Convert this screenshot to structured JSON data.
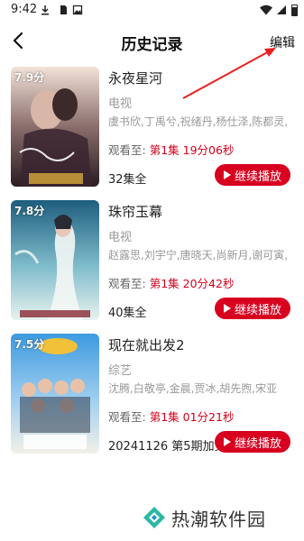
{
  "status_bar": {
    "time": "9:42",
    "icons": [
      "download-icon",
      "sim-card-icon",
      "image-icon",
      "wifi-icon",
      "signal-icon",
      "battery-icon"
    ]
  },
  "nav": {
    "title": "历史记录",
    "edit_label": "编辑",
    "back_icon": "chevron-left-icon"
  },
  "labels": {
    "watched_prefix": "观看至:",
    "continue_label": "继续播放"
  },
  "history": [
    {
      "rating": "7.9分",
      "title": "永夜星河",
      "category": "电视",
      "cast": "虞书欣,丁禹兮,祝绪丹,杨仕泽,陈都灵,",
      "watched_episode": "第1集 19分06秒",
      "episodes": "32集全",
      "poster_text": "11月1日起",
      "colors": [
        "#3b2a2a",
        "#c9a7a0",
        "#f2d6c8"
      ]
    },
    {
      "rating": "7.8分",
      "title": "珠帘玉幕",
      "category": "电视",
      "cast": "赵露思,刘宇宁,唐晓天,尚新月,谢可寅,",
      "watched_episode": "第1集 20分42秒",
      "episodes": "40集全",
      "poster_text": "",
      "colors": [
        "#2e6f8e",
        "#7fb9c9",
        "#d9ecef"
      ]
    },
    {
      "rating": "7.5分",
      "title": "现在就出发2",
      "category": "综艺",
      "cast": "沈腾,白敬亭,金晨,贾冰,胡先煦,宋亚",
      "watched_episode": "第1集 01分21秒",
      "episodes": "20241126 第5期加更",
      "poster_text": "",
      "colors": [
        "#1f7fcf",
        "#f0c23a",
        "#6bb36a"
      ]
    }
  ],
  "watermark": {
    "text": "热潮软件园"
  },
  "accent_color": "#d8001f",
  "annotation_color": "#e8211d"
}
